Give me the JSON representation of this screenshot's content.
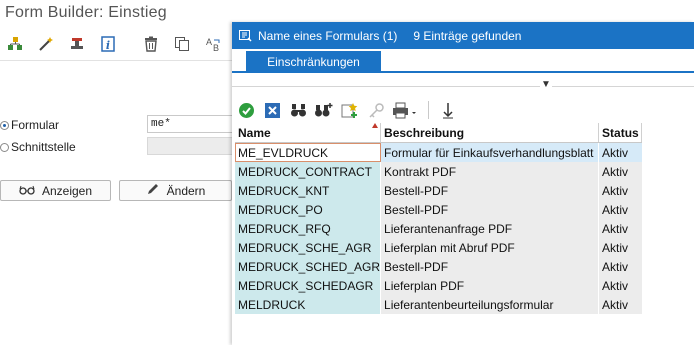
{
  "background": {
    "title": "Form Builder: Einstieg",
    "toolbar_icons": [
      "hierarchy-icon",
      "magic-wand-icon",
      "stamp-icon",
      "info-icon",
      "trash-icon",
      "copy-icon",
      "rename-icon"
    ],
    "radio_formular": "Formular",
    "radio_schnittstelle": "Schnittstelle",
    "formular_value": "me*",
    "schnittstelle_value": "",
    "btn_anzeigen": "Anzeigen",
    "btn_aendern": "Ändern"
  },
  "dialog": {
    "title": "Name eines Formulars (1)",
    "count_text": "9 Einträge gefunden",
    "tab_label": "Einschränkungen",
    "toolbar_icons": [
      "check-icon",
      "cancel-icon",
      "binoculars-icon",
      "binoculars-plus-icon",
      "new-entry-icon",
      "key-icon",
      "print-icon",
      "sort-icon"
    ],
    "colors": {
      "accent": "#1b73c5",
      "name_col": "#cde9ec",
      "row_bg": "#ececec",
      "selected": "#d6eaf8"
    },
    "columns": [
      "Name",
      "Beschreibung",
      "Status"
    ],
    "rows": [
      {
        "name": "ME_EVLDRUCK",
        "desc": "Formular für Einkaufsverhandlungsblatt",
        "status": "Aktiv"
      },
      {
        "name": "MEDRUCK_CONTRACT",
        "desc": "Kontrakt PDF",
        "status": "Aktiv"
      },
      {
        "name": "MEDRUCK_KNT",
        "desc": "Bestell-PDF",
        "status": "Aktiv"
      },
      {
        "name": "MEDRUCK_PO",
        "desc": "Bestell-PDF",
        "status": "Aktiv"
      },
      {
        "name": "MEDRUCK_RFQ",
        "desc": "Lieferantenanfrage PDF",
        "status": "Aktiv"
      },
      {
        "name": "MEDRUCK_SCHE_AGR",
        "desc": "Lieferplan mit Abruf PDF",
        "status": "Aktiv"
      },
      {
        "name": "MEDRUCK_SCHED_AGR",
        "desc": "Bestell-PDF",
        "status": "Aktiv"
      },
      {
        "name": "MEDRUCK_SCHEDAGR",
        "desc": "Lieferplan PDF",
        "status": "Aktiv"
      },
      {
        "name": "MELDRUCK",
        "desc": "Lieferantenbeurteilungsformular",
        "status": "Aktiv"
      }
    ]
  }
}
